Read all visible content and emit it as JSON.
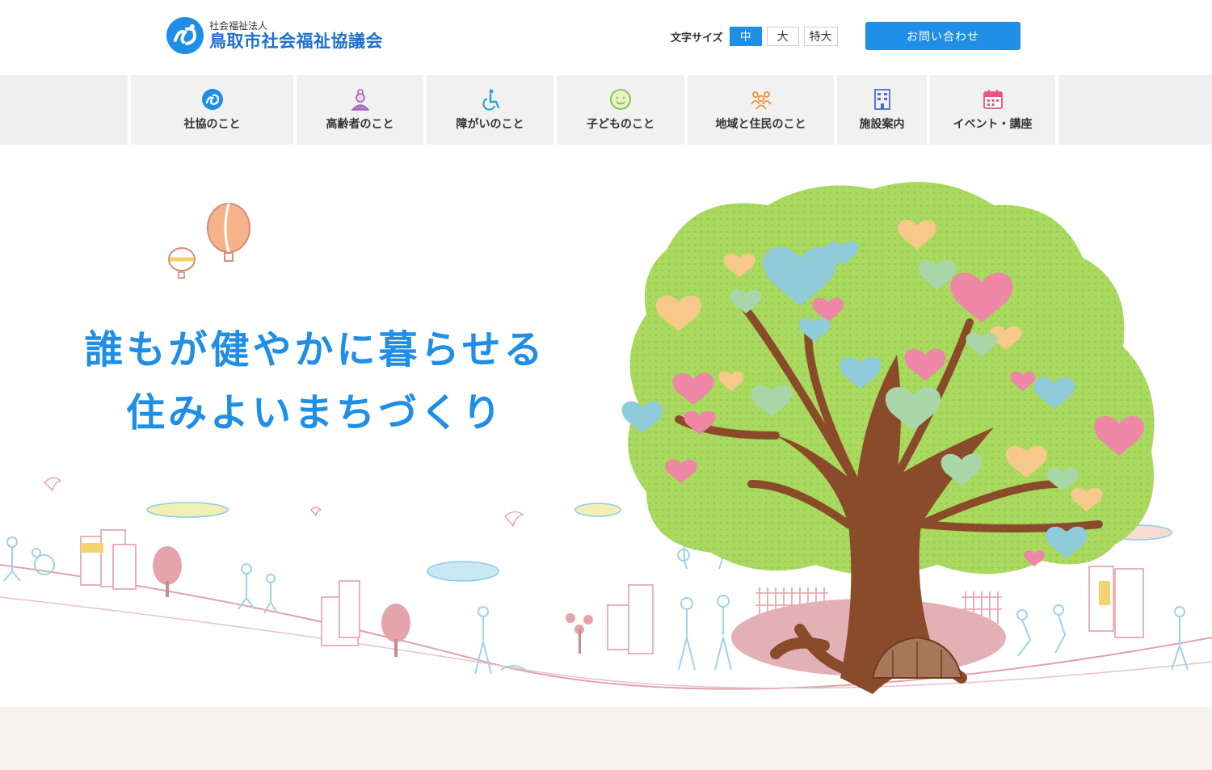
{
  "header": {
    "logo_sub": "社会福祉法人",
    "logo_main": "鳥取市社会福祉協議会",
    "logo_icon": "shakyo-logo-icon",
    "font_size_label": "文字サイズ",
    "font_size_options": [
      "中",
      "大",
      "特大"
    ],
    "font_size_selected": "中",
    "contact_label": "お問い合わせ"
  },
  "nav": {
    "items": [
      {
        "label": "社協のこと",
        "icon": "shakyo-logo-icon"
      },
      {
        "label": "高齢者のこと",
        "icon": "elderly-person-icon"
      },
      {
        "label": "障がいのこと",
        "icon": "wheelchair-icon"
      },
      {
        "label": "子どものこと",
        "icon": "child-face-icon"
      },
      {
        "label": "地域と住民のこと",
        "icon": "community-people-icon"
      },
      {
        "label": "施設案内",
        "icon": "building-icon"
      },
      {
        "label": "イベント・講座",
        "icon": "calendar-icon"
      }
    ]
  },
  "hero": {
    "catch_line1": "誰もが健やかに暮らせる",
    "catch_line2": "住みよいまちづくり"
  },
  "colors": {
    "brand_blue": "#1e8ee6",
    "nav_bg": "#f1f1f1",
    "tree_green": "#a8d85c",
    "tree_trunk": "#8a4b2a"
  }
}
